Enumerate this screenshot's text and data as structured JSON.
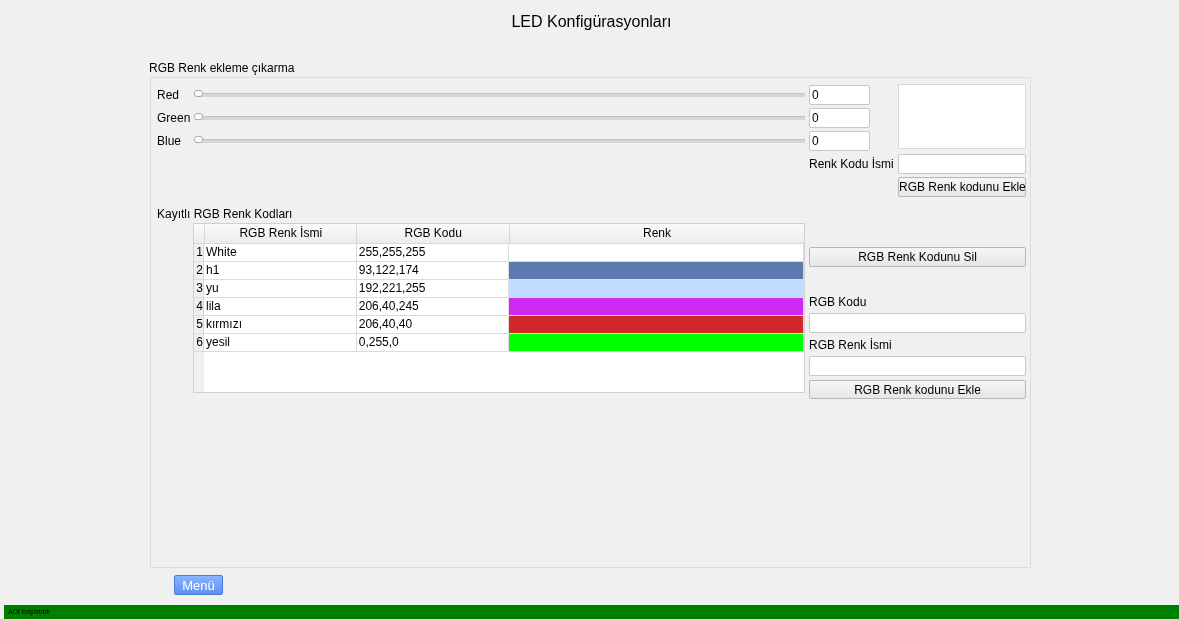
{
  "window": {
    "title": "LED Konfigürasyonları"
  },
  "rgb_group": {
    "title": "RGB Renk ekleme çıkarma",
    "sliders": [
      {
        "label": "Red",
        "level": 0,
        "value": "0"
      },
      {
        "label": "Green",
        "level": 0,
        "value": "0"
      },
      {
        "label": "Blue",
        "level": 0,
        "value": "0"
      }
    ],
    "name_label": "Renk Kodu İsmi",
    "add_button": "RGB Renk kodunu Ekle"
  },
  "saved": {
    "title": "Kayıtlı RGB Renk Kodları",
    "table": {
      "columns": [
        "RGB Renk İsmi",
        "RGB Kodu",
        "Renk"
      ],
      "rows": [
        {
          "index": "1",
          "name": "White",
          "code": "255,255,255",
          "color": "#ffffff"
        },
        {
          "index": "2",
          "name": "h1",
          "code": "93,122,174",
          "color": "#5d7aae"
        },
        {
          "index": "3",
          "name": "yu",
          "code": "192,221,255",
          "color": "#c0ddff"
        },
        {
          "index": "4",
          "name": "lila",
          "code": "206,40,245",
          "color": "#ce28f5"
        },
        {
          "index": "5",
          "name": "kırmızı",
          "code": "206,40,40",
          "color": "#ce2828"
        },
        {
          "index": "6",
          "name": "yesil",
          "code": "0,255,0",
          "color": "#00ff00"
        }
      ]
    },
    "delete_button": "RGB Renk Kodunu Sil",
    "code_label": "RGB Kodu",
    "name_label": "RGB Renk İsmi",
    "add_button": "RGB Renk kodunu Ekle"
  },
  "menu_button": "Menü",
  "status_bar": "AOI başlatıldı"
}
